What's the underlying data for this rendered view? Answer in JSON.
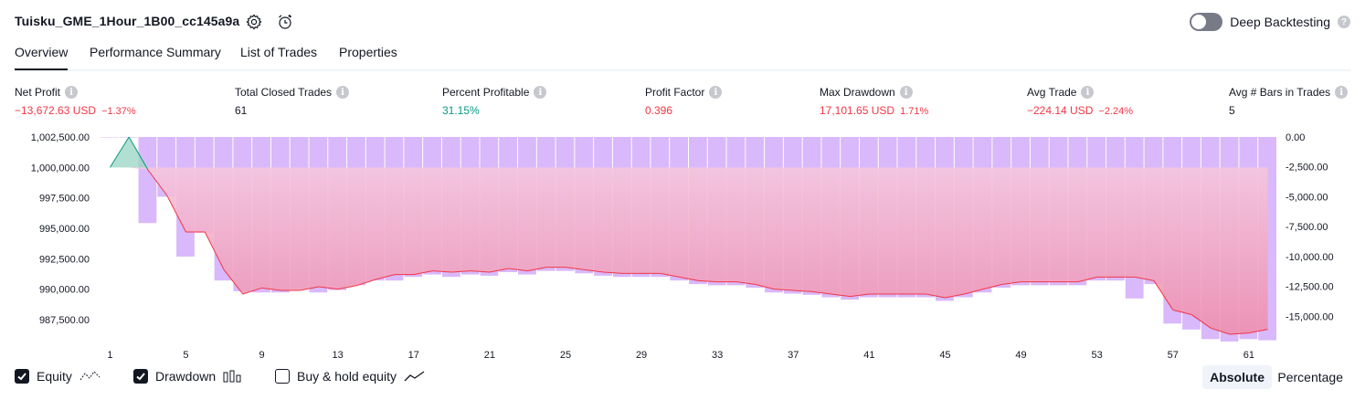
{
  "header": {
    "strategy_title": "Tuisku_GME_1Hour_1B00_cc145a9a",
    "settings_icon": "gear-icon",
    "alert_icon": "alarm-clock-plus-icon",
    "deep_backtesting_label": "Deep Backtesting",
    "deep_backtesting_enabled": false,
    "help_icon": "question-icon"
  },
  "tabs": [
    {
      "label": "Overview",
      "active": true
    },
    {
      "label": "Performance Summary",
      "active": false
    },
    {
      "label": "List of Trades",
      "active": false
    },
    {
      "label": "Properties",
      "active": false
    }
  ],
  "stats": [
    {
      "label": "Net Profit",
      "value": "−13,672.63 USD",
      "pct": "−1.37%",
      "tone": "neg"
    },
    {
      "label": "Total Closed Trades",
      "value": "61",
      "pct": "",
      "tone": "neutral"
    },
    {
      "label": "Percent Profitable",
      "value": "31.15%",
      "pct": "",
      "tone": "pos"
    },
    {
      "label": "Profit Factor",
      "value": "0.396",
      "pct": "",
      "tone": "neg"
    },
    {
      "label": "Max Drawdown",
      "value": "17,101.65 USD",
      "pct": "1.71%",
      "tone": "neg"
    },
    {
      "label": "Avg Trade",
      "value": "−224.14 USD",
      "pct": "−2.24%",
      "tone": "neg"
    },
    {
      "label": "Avg # Bars in Trades",
      "value": "5",
      "pct": "",
      "tone": "neutral"
    }
  ],
  "legend": {
    "equity_label": "Equity",
    "equity_checked": true,
    "drawdown_label": "Drawdown",
    "drawdown_checked": true,
    "buyhold_label": "Buy & hold equity",
    "buyhold_checked": false
  },
  "mode": {
    "absolute_label": "Absolute",
    "percentage_label": "Percentage",
    "selected": "Absolute"
  },
  "colors": {
    "negative": "#f23645",
    "positive": "#089981",
    "drawdown_bar": "#d9b8fb",
    "equity_fill_top": "#f5c6dd",
    "equity_fill_bottom": "#ee8fae"
  },
  "chart_data": {
    "type": "area",
    "x": [
      1,
      2,
      3,
      4,
      5,
      6,
      7,
      8,
      9,
      10,
      11,
      12,
      13,
      14,
      15,
      16,
      17,
      18,
      19,
      20,
      21,
      22,
      23,
      24,
      25,
      26,
      27,
      28,
      29,
      30,
      31,
      32,
      33,
      34,
      35,
      36,
      37,
      38,
      39,
      40,
      41,
      42,
      43,
      44,
      45,
      46,
      47,
      48,
      49,
      50,
      51,
      52,
      53,
      54,
      55,
      56,
      57,
      58,
      59,
      60,
      61,
      62
    ],
    "x_ticks": [
      "1",
      "5",
      "9",
      "13",
      "17",
      "21",
      "25",
      "29",
      "33",
      "37",
      "41",
      "45",
      "49",
      "53",
      "57",
      "61"
    ],
    "y_left_ticks": [
      "1,002,500.00",
      "1,000,000.00",
      "997,500.00",
      "995,000.00",
      "992,500.00",
      "990,000.00",
      "987,500.00"
    ],
    "y_left_range": [
      986000,
      1002500
    ],
    "y_right_ticks": [
      "0.00",
      "-2,500.00",
      "-5,000.00",
      "-7,500.00",
      "-10,000.00",
      "-12,500.00",
      "-15,000.00"
    ],
    "y_right_range": [
      -16800,
      0
    ],
    "series": [
      {
        "name": "Equity",
        "values": [
          1000000,
          1002500,
          999800,
          997700,
          994700,
          994700,
          991600,
          989600,
          990100,
          989900,
          989900,
          990200,
          990000,
          990300,
          990800,
          991200,
          991200,
          991500,
          991400,
          991500,
          991400,
          991700,
          991500,
          991800,
          991800,
          991600,
          991400,
          991300,
          991300,
          991300,
          991000,
          990700,
          990600,
          990600,
          990400,
          990000,
          989900,
          989800,
          989600,
          989400,
          989600,
          989600,
          989600,
          989600,
          989300,
          989600,
          990000,
          990400,
          990600,
          990600,
          990600,
          990600,
          991000,
          991000,
          991000,
          990700,
          988300,
          987900,
          986800,
          986300,
          986400,
          986700
        ]
      },
      {
        "name": "Drawdown",
        "values": [
          0,
          0,
          -7200,
          -5000,
          -10000,
          -8000,
          -12000,
          -12900,
          -13000,
          -13000,
          -12700,
          -13000,
          -12800,
          -12400,
          -12000,
          -12000,
          -11700,
          -11500,
          -11700,
          -11500,
          -11600,
          -11300,
          -11500,
          -11200,
          -11200,
          -11400,
          -11600,
          -11700,
          -11700,
          -11700,
          -12000,
          -12300,
          -12400,
          -12400,
          -12600,
          -13000,
          -13100,
          -13200,
          -13400,
          -13600,
          -13400,
          -13400,
          -13400,
          -13400,
          -13700,
          -13400,
          -13000,
          -12600,
          -12400,
          -12400,
          -12400,
          -12400,
          -12000,
          -12000,
          -13500,
          -12300,
          -15600,
          -16100,
          -16900,
          -17100,
          -16900,
          -17000
        ]
      }
    ]
  }
}
